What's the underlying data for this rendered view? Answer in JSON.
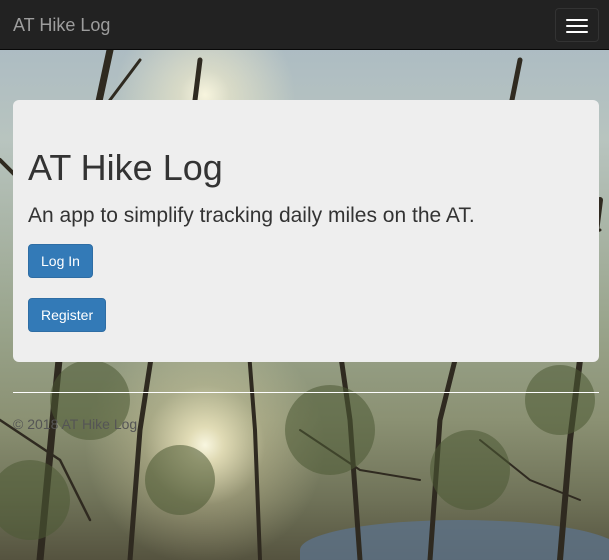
{
  "navbar": {
    "brand": "AT Hike Log",
    "toggle_icon": "hamburger-menu-icon"
  },
  "jumbotron": {
    "title": "AT Hike Log",
    "lead": "An app to simplify tracking daily miles on the AT.",
    "login_label": "Log In",
    "register_label": "Register"
  },
  "footer": {
    "text": "© 2018 AT Hike Log"
  },
  "colors": {
    "navbar_bg": "#222222",
    "brand_text": "#9d9d9d",
    "jumbotron_bg": "#eeeeee",
    "primary_button": "#337ab7"
  }
}
